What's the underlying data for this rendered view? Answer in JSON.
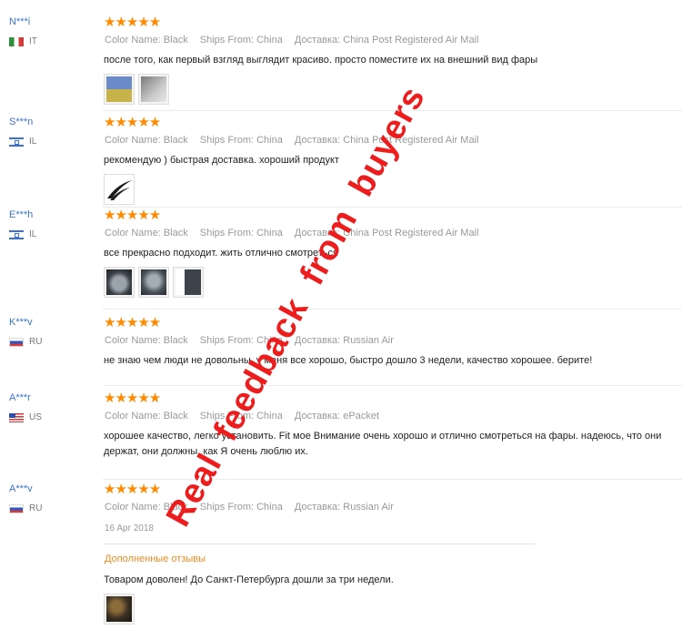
{
  "reviews": [
    {
      "user": "N***i",
      "country": "IT",
      "stars": "★★★★★",
      "color": "Color Name: Black",
      "ships": "Ships From: China",
      "delivery": "Доставка: China Post Registered Air Mail",
      "text": "после того, как первый взгляд выглядит красиво. просто поместите их на внешний вид фары"
    },
    {
      "user": "S***n",
      "country": "IL",
      "stars": "★★★★★",
      "color": "Color Name: Black",
      "ships": "Ships From: China",
      "delivery": "Доставка: China Post Registered Air Mail",
      "text": "рекомендую ) быстрая доставка. хороший продукт"
    },
    {
      "user": "E***h",
      "country": "IL",
      "stars": "★★★★★",
      "color": "Color Name: Black",
      "ships": "Ships From: China",
      "delivery": "Доставка: China Post Registered Air Mail",
      "text": "все прекрасно подходит. жить отлично смотреться"
    },
    {
      "user": "K***v",
      "country": "RU",
      "stars": "★★★★★",
      "color": "Color Name: Black",
      "ships": "Ships From: China",
      "delivery": "Доставка: Russian Air",
      "text": "не знаю чем люди не довольны, у меня все хорошо, быстро дошло 3 недели, качество хорошее. берите!"
    },
    {
      "user": "A***r",
      "country": "US",
      "stars": "★★★★★",
      "color": "Color Name: Black",
      "ships": "Ships From: China",
      "delivery": "Доставка: ePacket",
      "text": "хорошее качество, легко установить. Fit мое Внимание очень хорошо и отлично смотреться на фары. надеюсь, что они держат, они должны, как Я очень люблю их."
    },
    {
      "user": "A***v",
      "country": "RU",
      "stars": "★★★★★",
      "color": "Color Name: Black",
      "ships": "Ships From: China",
      "delivery": "Доставка: Russian Air",
      "date": "16 Apr 2018",
      "additional_label": "Дополненные отзывы",
      "text": "Товаром доволен! До Санкт-Петербурга дошли за три недели."
    }
  ],
  "watermark": "Real  feedback  from  buyers"
}
